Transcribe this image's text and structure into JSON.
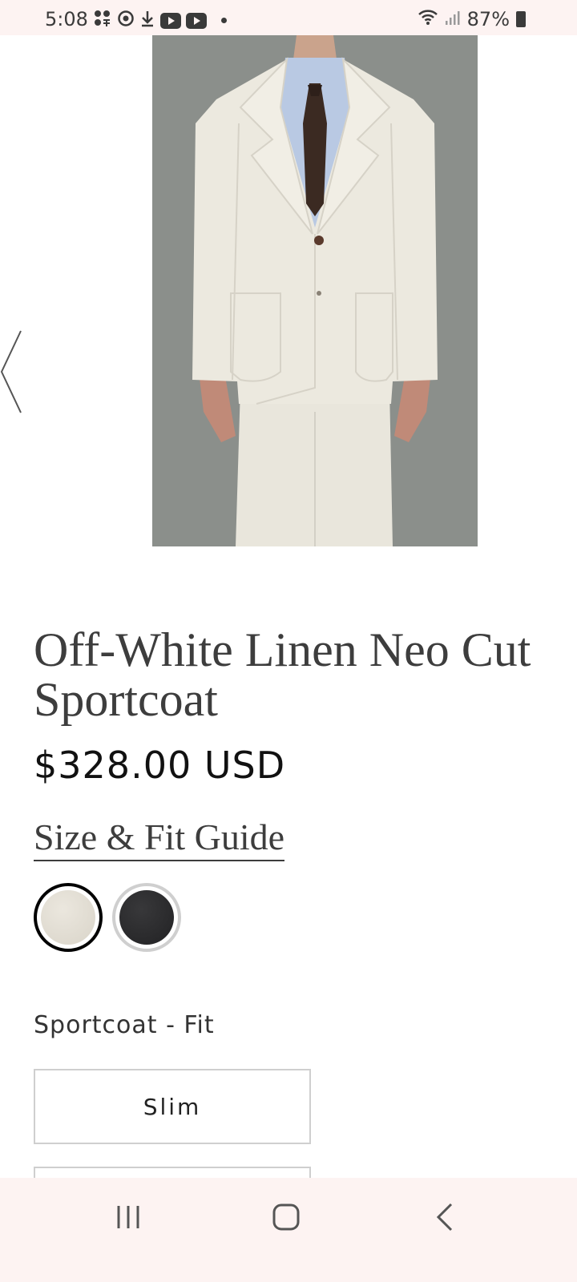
{
  "status_bar": {
    "time": "5:08",
    "battery": "87%"
  },
  "product": {
    "title": "Off-White Linen Neo Cut Sportcoat",
    "price": "$328.00 USD",
    "size_guide_label": "Size & Fit Guide"
  },
  "swatches": [
    {
      "name": "off-white",
      "color": "#e3ded4",
      "selected": true
    },
    {
      "name": "black",
      "color": "#2a2a2c",
      "selected": false
    }
  ],
  "fit": {
    "label": "Sportcoat - Fit",
    "options": [
      {
        "label": "Slim"
      },
      {
        "label": ""
      }
    ]
  },
  "colors": {
    "status_bar_bg": "#fdf3f2",
    "image_background": "#8b8f8b",
    "jacket": "#ece9df",
    "tie": "#3b2a22",
    "shirt": "#b9c9e3"
  },
  "nav": {
    "recent": "recent-apps-icon",
    "home": "home-icon",
    "back": "back-icon"
  }
}
